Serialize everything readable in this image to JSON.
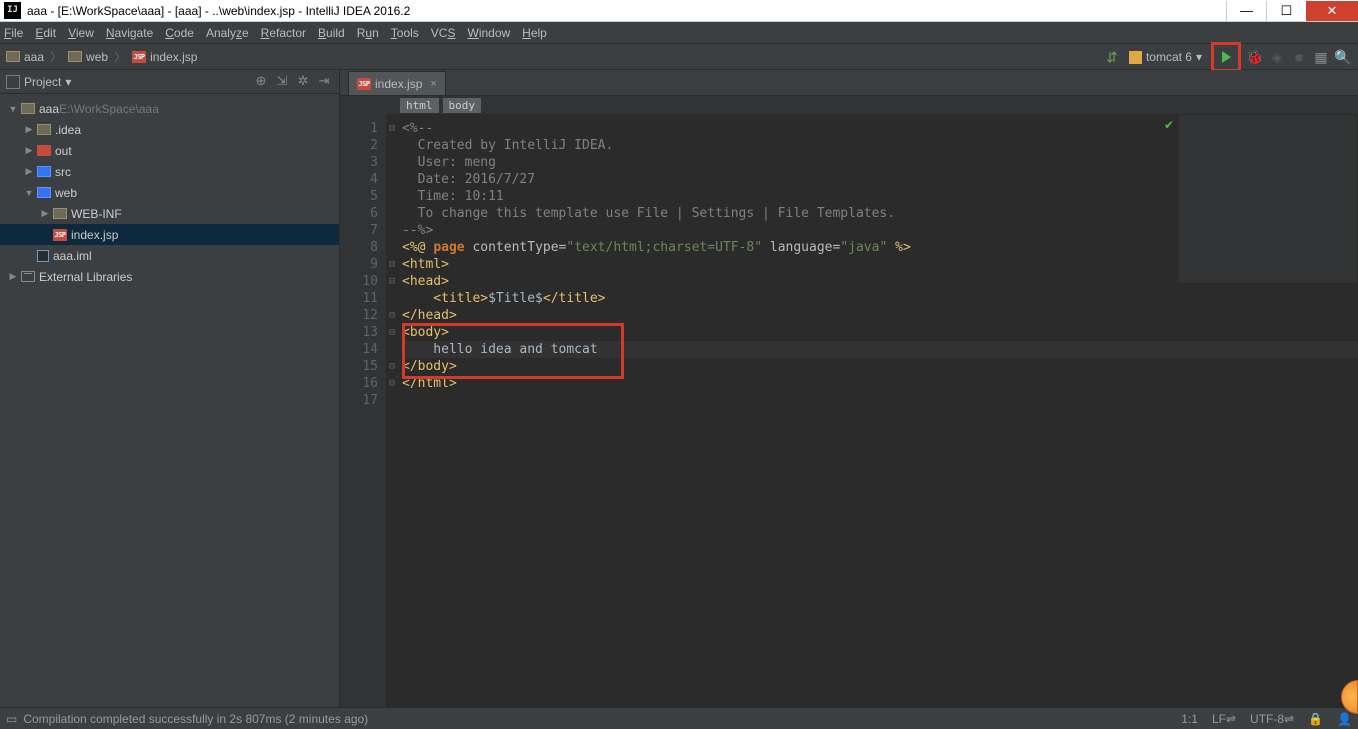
{
  "window": {
    "title": "aaa - [E:\\WorkSpace\\aaa] - [aaa] - ..\\web\\index.jsp - IntelliJ IDEA 2016.2",
    "app_icon_text": "IJ"
  },
  "menu": {
    "file": "File",
    "edit": "Edit",
    "view": "View",
    "navigate": "Navigate",
    "code": "Code",
    "analyze": "Analyze",
    "refactor": "Refactor",
    "build": "Build",
    "run": "Run",
    "tools": "Tools",
    "vcs": "VCS",
    "window": "Window",
    "help": "Help"
  },
  "breadcrumbs": [
    {
      "icon": "folder",
      "label": "aaa"
    },
    {
      "icon": "folder",
      "label": "web"
    },
    {
      "icon": "jsp",
      "label": "index.jsp"
    }
  ],
  "toolbar": {
    "build_icon": "⇵",
    "config_selected": "tomcat 6",
    "config_caret": "▾"
  },
  "project": {
    "header": "Project",
    "caret": "▾",
    "tree": [
      {
        "lvl": 1,
        "tw": "▼",
        "icon": "folder",
        "cls": "",
        "label": "aaa",
        "suffix": "  E:\\WorkSpace\\aaa"
      },
      {
        "lvl": 2,
        "tw": "▶",
        "icon": "folder",
        "cls": "",
        "label": ".idea"
      },
      {
        "lvl": 2,
        "tw": "▶",
        "icon": "folder",
        "cls": "f-red",
        "label": "out"
      },
      {
        "lvl": 2,
        "tw": "▶",
        "icon": "folder",
        "cls": "f-blue",
        "label": "src"
      },
      {
        "lvl": 2,
        "tw": "▼",
        "icon": "folder",
        "cls": "f-blue",
        "label": "web"
      },
      {
        "lvl": 3,
        "tw": "▶",
        "icon": "folder",
        "cls": "",
        "label": "WEB-INF"
      },
      {
        "lvl": 3,
        "tw": "",
        "icon": "jsp",
        "cls": "",
        "label": "index.jsp",
        "sel": true
      },
      {
        "lvl": 2,
        "tw": "",
        "icon": "iml",
        "cls": "",
        "label": "aaa.iml"
      },
      {
        "lvl": 1,
        "tw": "▶",
        "icon": "lib",
        "cls": "",
        "label": "External Libraries"
      }
    ]
  },
  "editor": {
    "tab_label": "index.jsp",
    "crumb1": "html",
    "crumb2": "body",
    "gutter": [
      "1",
      "2",
      "3",
      "4",
      "5",
      "6",
      "7",
      "8",
      "9",
      "10",
      "11",
      "12",
      "13",
      "14",
      "15",
      "16",
      "17"
    ],
    "lines": {
      "l1_a": "<%--",
      "l2": "  Created by IntelliJ IDEA.",
      "l3": "  User: meng",
      "l4": "  Date: 2016/7/27",
      "l5": "  Time: 10:11",
      "l6": "  To change this template use File | Settings | File Templates.",
      "l7": "--%>",
      "l8_a": "<%@ ",
      "l8_b": "page",
      "l8_c": " contentType=",
      "l8_d": "\"text/html;charset=UTF-8\"",
      "l8_e": " language=",
      "l8_f": "\"java\"",
      "l8_g": " %>",
      "l9": "<html>",
      "l10": "<head>",
      "l11_a": "    <title>",
      "l11_b": "$Title$",
      "l11_c": "</title>",
      "l12": "</head>",
      "l13": "<body>",
      "l14": "    hello idea and tomcat",
      "l15": "</body>",
      "l16": "</html>",
      "l17": ""
    }
  },
  "status": {
    "msg": "Compilation completed successfully in 2s 807ms (2 minutes ago)",
    "pos": "1:1",
    "le": "LF⇌",
    "enc": "UTF-8⇌"
  }
}
